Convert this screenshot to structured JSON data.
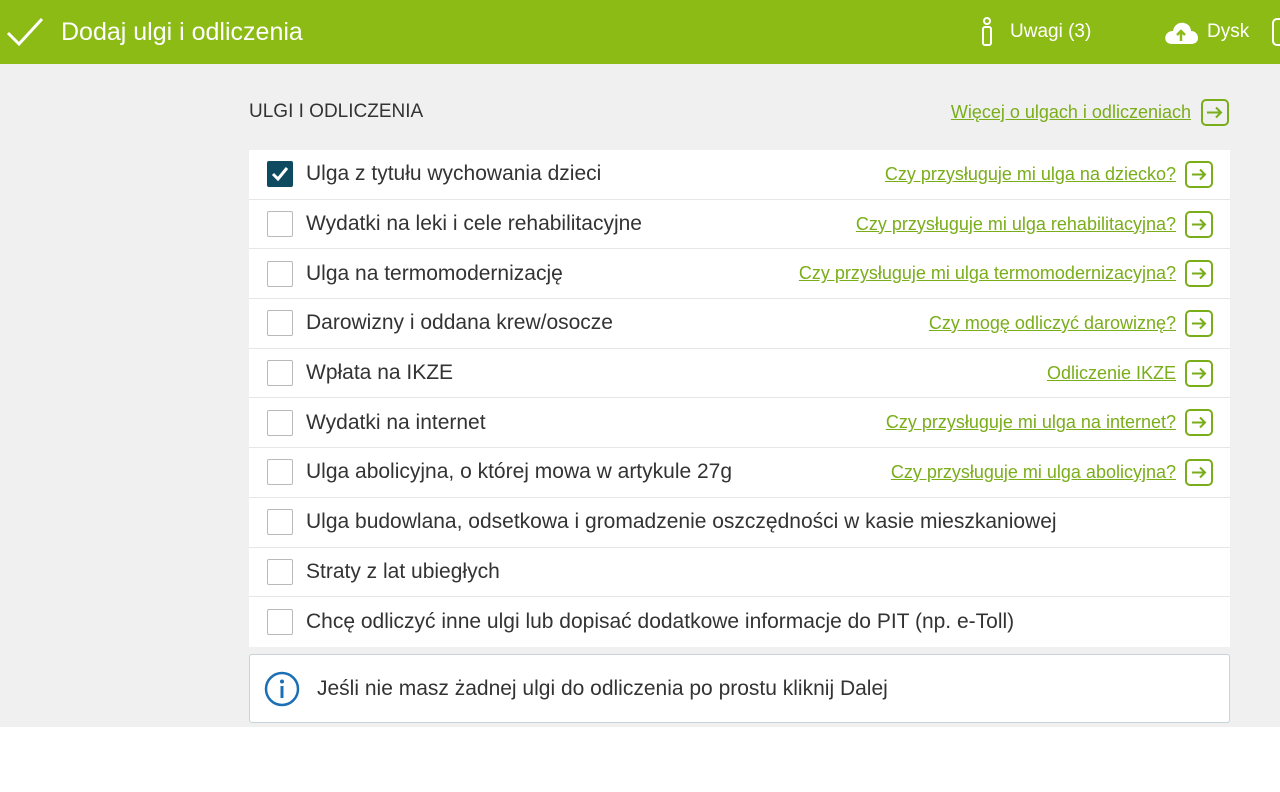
{
  "header": {
    "title": "Dodaj ulgi i odliczenia",
    "notes_label": "Uwagi (3)",
    "drive_label": "Dysk",
    "bg_color": "#8cbb16"
  },
  "section": {
    "title": "ULGI I ODLICZENIA",
    "more_link": "Więcej o ulgach i odliczeniach"
  },
  "deductions": [
    {
      "label": "Ulga z tytułu wychowania dzieci",
      "checked": true,
      "help": "Czy przysługuje mi ulga na dziecko?"
    },
    {
      "label": "Wydatki na leki i cele rehabilitacyjne",
      "checked": false,
      "help": "Czy przysługuje mi ulga rehabilitacyjna?"
    },
    {
      "label": "Ulga na termomodernizację",
      "checked": false,
      "help": "Czy przysługuje mi ulga termomodernizacyjna?"
    },
    {
      "label": "Darowizny i oddana krew/osocze",
      "checked": false,
      "help": "Czy mogę odliczyć darowiznę?"
    },
    {
      "label": "Wpłata na IKZE",
      "checked": false,
      "help": "Odliczenie IKZE"
    },
    {
      "label": "Wydatki na internet",
      "checked": false,
      "help": "Czy przysługuje mi ulga na internet?"
    },
    {
      "label": "Ulga abolicyjna, o której mowa w artykule 27g",
      "checked": false,
      "help": "Czy przysługuje mi ulga abolicyjna?"
    },
    {
      "label": "Ulga budowlana, odsetkowa i gromadzenie oszczędności w kasie mieszkaniowej",
      "checked": false,
      "help": ""
    },
    {
      "label": "Straty z lat ubiegłych",
      "checked": false,
      "help": ""
    },
    {
      "label": "Chcę odliczyć inne ulgi lub dopisać dodatkowe informacje do PIT (np. e-Toll)",
      "checked": false,
      "help": ""
    }
  ],
  "info": {
    "text": "Jeśli nie masz żadnej ulgi do odliczenia po prostu kliknij Dalej"
  },
  "colors": {
    "accent": "#7aad1a",
    "checkbox_checked": "#0e4a60",
    "info_icon": "#1c6fb5"
  }
}
